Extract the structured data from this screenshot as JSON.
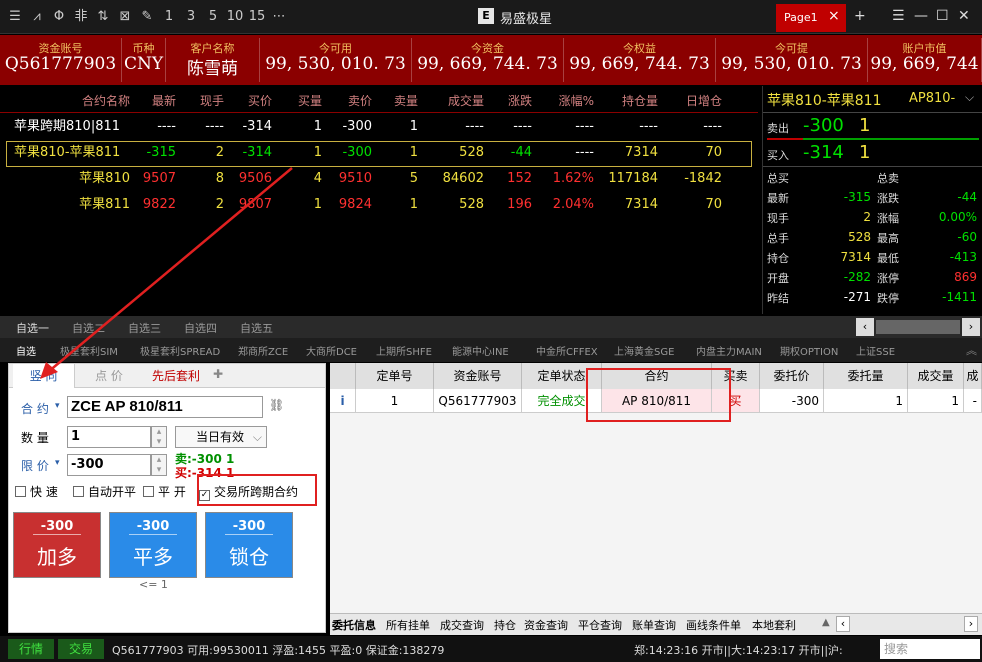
{
  "toolbar": {
    "icons": [
      "menu-icon",
      "chart-line-icon",
      "candle-icon",
      "bars-icon",
      "split-icon",
      "calc-icon",
      "pen-icon",
      "one-icon",
      "three-icon",
      "five-icon",
      "ten-icon",
      "fifteen-icon",
      "more-icon"
    ],
    "icon_glyphs": [
      "☰",
      "⩘",
      "Φ",
      "非",
      "⇅",
      "⊠",
      "✎",
      "1",
      "3",
      "5",
      "10",
      "15",
      "⋯"
    ]
  },
  "app": {
    "title": "易盛极星",
    "logo": "E",
    "page_tab": "Page1",
    "close": "×",
    "plus": "+",
    "win_menu": "☰",
    "win_min": "—",
    "win_max": "☐",
    "win_close": "✕"
  },
  "account": [
    {
      "label": "资金账号",
      "value": "Q561777903"
    },
    {
      "label": "币种",
      "value": "CNY"
    },
    {
      "label": "客户名称",
      "value": "陈雪萌"
    },
    {
      "label": "今可用",
      "value": "99, 530, 010. 73"
    },
    {
      "label": "今资金",
      "value": "99, 669, 744. 73"
    },
    {
      "label": "今权益",
      "value": "99, 669, 744. 73"
    },
    {
      "label": "今可提",
      "value": "99, 530, 010. 73"
    },
    {
      "label": "账户市值",
      "value": "99, 669, 744"
    }
  ],
  "quote": {
    "headers": [
      "合约名称",
      "最新",
      "现手",
      "买价",
      "买量",
      "卖价",
      "卖量",
      "成交量",
      "涨跌",
      "涨幅%",
      "持仓量",
      "日增仓"
    ],
    "rows": [
      [
        "苹果跨期810|811",
        "----",
        "----",
        "-314",
        "1",
        "-300",
        "1",
        "----",
        "----",
        "----",
        "----",
        "----"
      ],
      [
        "苹果810-苹果811",
        "-315",
        "2",
        "-314",
        "1",
        "-300",
        "1",
        "528",
        "-44",
        "----",
        "7314",
        "70"
      ],
      [
        "苹果810",
        "9507",
        "8",
        "9506",
        "4",
        "9510",
        "5",
        "84602",
        "152",
        "1.62%",
        "117184",
        "-1842"
      ],
      [
        "苹果811",
        "9822",
        "2",
        "9807",
        "1",
        "9824",
        "1",
        "528",
        "196",
        "2.04%",
        "7314",
        "70"
      ]
    ]
  },
  "depth": {
    "title": "苹果810-苹果811",
    "code": "AP810-",
    "sell_label": "卖出",
    "sell_price": "-300",
    "sell_qty": "1",
    "buy_label": "买入",
    "buy_price": "-314",
    "buy_qty": "1",
    "stats_left": [
      [
        "总买",
        ""
      ],
      [
        "最新",
        "-315"
      ],
      [
        "现手",
        "2"
      ],
      [
        "总手",
        "528"
      ],
      [
        "持仓",
        "7314"
      ],
      [
        "开盘",
        "-282"
      ],
      [
        "昨结",
        "-271"
      ]
    ],
    "stats_right": [
      [
        "总卖",
        ""
      ],
      [
        "涨跌",
        "-44"
      ],
      [
        "涨幅",
        "0.00%"
      ],
      [
        "最高",
        "-60"
      ],
      [
        "最低",
        "-413"
      ],
      [
        "涨停",
        "869"
      ],
      [
        "跌停",
        "-1411"
      ]
    ]
  },
  "group_tabs": [
    "自选一",
    "自选二",
    "自选三",
    "自选四",
    "自选五"
  ],
  "market_tabs": [
    "自选",
    "极星套利SIM",
    "极星套利SPREAD",
    "郑商所ZCE",
    "大商所DCE",
    "上期所SHFE",
    "能源中心INE",
    "中金所CFFEX",
    "上海黄金SGE",
    "内盘主力MAIN",
    "期权OPTION",
    "上证SSE"
  ],
  "order": {
    "tabs": [
      "竖 向",
      "点 价",
      "先后套利"
    ],
    "contract_label": "合 约",
    "contract_value": "ZCE AP 810/811",
    "qty_label": "数 量",
    "qty_value": "1",
    "validity": "当日有效",
    "price_label": "限 价",
    "price_value": "-300",
    "hint_sell": "卖:-300 1",
    "hint_buy": "买:-314 1",
    "checks": [
      "快 速",
      "自动开平",
      "平 开",
      "交易所跨期合约"
    ],
    "buttons": [
      {
        "price": "-300",
        "label": "加多"
      },
      {
        "price": "-300",
        "label": "平多"
      },
      {
        "price": "-300",
        "label": "锁仓"
      }
    ],
    "sub_hint": "<= 1"
  },
  "grid": {
    "headers": [
      "",
      "定单号",
      "资金账号",
      "定单状态",
      "合约",
      "买卖",
      "委托价",
      "委托量",
      "成交量",
      "成交"
    ],
    "row": [
      "i",
      "1",
      "Q561777903",
      "完全成交",
      "AP 810/811",
      "买",
      "-300",
      "1",
      "1",
      "-"
    ]
  },
  "bottom_tabs": [
    "委托信息",
    "所有挂单",
    "成交查询",
    "持仓",
    "资金查询",
    "平仓查询",
    "账单查询",
    "画线条件单",
    "本地套利"
  ],
  "status": {
    "tab1": "行情",
    "tab2": "交易",
    "info": "Q561777903 可用:99530011 浮盈:1455 平盈:0 保证金:138279",
    "time": "郑:14:23:16 开市||大:14:23:17 开市||沪:",
    "search_placeholder": "搜索"
  },
  "colors": {
    "red": "#ff3030",
    "green": "#00e000",
    "yellow": "#f0e040",
    "accent": "#c00000",
    "blue": "#2a8be8"
  }
}
